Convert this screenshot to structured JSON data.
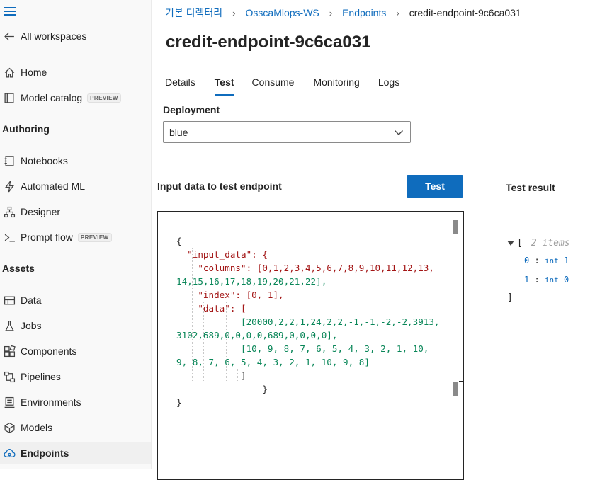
{
  "sidebar": {
    "back_label": "All workspaces",
    "items": [
      {
        "label": "Home",
        "icon": "home-icon"
      },
      {
        "label": "Model catalog",
        "icon": "catalog-icon",
        "badge": "PREVIEW"
      }
    ],
    "sections": [
      {
        "title": "Authoring",
        "items": [
          {
            "label": "Notebooks",
            "icon": "notebook-icon"
          },
          {
            "label": "Automated ML",
            "icon": "automl-icon"
          },
          {
            "label": "Designer",
            "icon": "designer-icon"
          },
          {
            "label": "Prompt flow",
            "icon": "promptflow-icon",
            "badge": "PREVIEW"
          }
        ]
      },
      {
        "title": "Assets",
        "items": [
          {
            "label": "Data",
            "icon": "data-icon"
          },
          {
            "label": "Jobs",
            "icon": "jobs-icon"
          },
          {
            "label": "Components",
            "icon": "components-icon"
          },
          {
            "label": "Pipelines",
            "icon": "pipelines-icon"
          },
          {
            "label": "Environments",
            "icon": "environments-icon"
          },
          {
            "label": "Models",
            "icon": "models-icon"
          },
          {
            "label": "Endpoints",
            "icon": "endpoints-icon",
            "active": true
          }
        ]
      }
    ]
  },
  "breadcrumb": [
    "기본 디렉터리",
    "OsscaMlops-WS",
    "Endpoints",
    "credit-endpoint-9c6ca031"
  ],
  "page_title": "credit-endpoint-9c6ca031",
  "tabs": [
    "Details",
    "Test",
    "Consume",
    "Monitoring",
    "Logs"
  ],
  "selected_tab": "Test",
  "deployment": {
    "label": "Deployment",
    "value": "blue"
  },
  "input_heading": "Input data to test endpoint",
  "test_button": "Test",
  "result_heading": "Test result",
  "editor_lines": [
    "{",
    "  \"input_data\": {",
    "    \"columns\": [0,1,2,3,4,5,6,7,8,9,10,11,12,13,",
    "14,15,16,17,18,19,20,21,22],",
    "    \"index\": [0, 1],",
    "    \"data\": [",
    "            [20000,2,2,1,24,2,2,-1,-1,-2,-2,3913,",
    "3102,689,0,0,0,0,689,0,0,0,0],",
    "            [10, 9, 8, 7, 6, 5, 4, 3, 2, 1, 10,",
    "9, 8, 7, 6, 5, 4, 3, 2, 1, 10, 9, 8]",
    "            ]",
    "                }",
    "}"
  ],
  "result": {
    "open": "[",
    "meta": "2 items",
    "rows": [
      {
        "index": "0",
        "type": "int",
        "value": "1"
      },
      {
        "index": "1",
        "type": "int",
        "value": "0"
      }
    ],
    "close": "]"
  }
}
